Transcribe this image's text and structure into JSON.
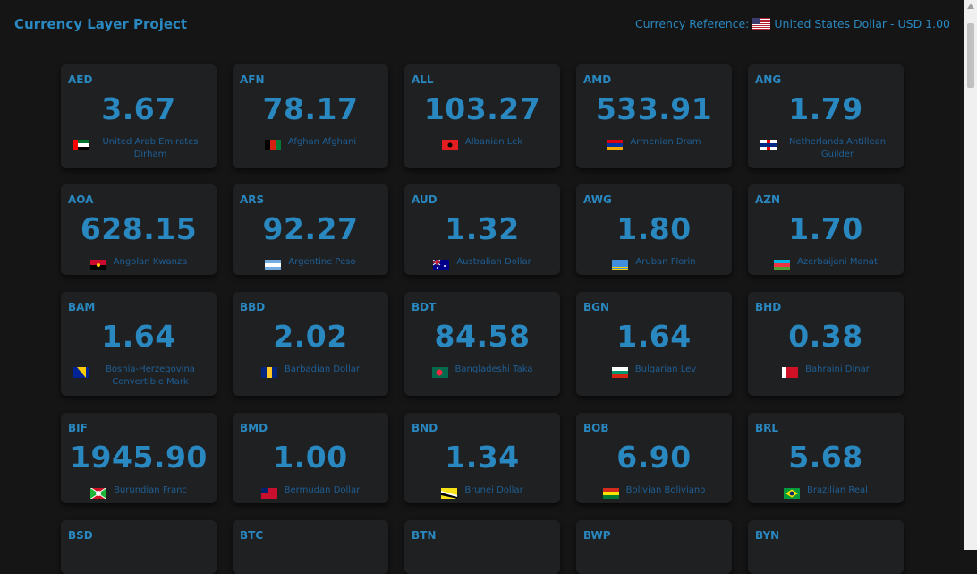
{
  "header": {
    "title": "Currency Layer Project",
    "reference_label": "Currency Reference:",
    "reference_value": "United States Dollar - USD 1.00",
    "reference_flag": "us-flag-icon"
  },
  "currencies": [
    {
      "code": "AED",
      "rate": "3.67",
      "name": "United Arab Emirates Dirham",
      "flag": "ae-flag-icon"
    },
    {
      "code": "AFN",
      "rate": "78.17",
      "name": "Afghan Afghani",
      "flag": "af-flag-icon"
    },
    {
      "code": "ALL",
      "rate": "103.27",
      "name": "Albanian Lek",
      "flag": "al-flag-icon"
    },
    {
      "code": "AMD",
      "rate": "533.91",
      "name": "Armenian Dram",
      "flag": "am-flag-icon"
    },
    {
      "code": "ANG",
      "rate": "1.79",
      "name": "Netherlands Antillean Guilder",
      "flag": "an-flag-icon"
    },
    {
      "code": "AOA",
      "rate": "628.15",
      "name": "Angolan Kwanza",
      "flag": "ao-flag-icon"
    },
    {
      "code": "ARS",
      "rate": "92.27",
      "name": "Argentine Peso",
      "flag": "ar-flag-icon"
    },
    {
      "code": "AUD",
      "rate": "1.32",
      "name": "Australian Dollar",
      "flag": "au-flag-icon"
    },
    {
      "code": "AWG",
      "rate": "1.80",
      "name": "Aruban Florin",
      "flag": "aw-flag-icon"
    },
    {
      "code": "AZN",
      "rate": "1.70",
      "name": "Azerbaijani Manat",
      "flag": "az-flag-icon"
    },
    {
      "code": "BAM",
      "rate": "1.64",
      "name": "Bosnia-Herzegovina Convertible Mark",
      "flag": "ba-flag-icon"
    },
    {
      "code": "BBD",
      "rate": "2.02",
      "name": "Barbadian Dollar",
      "flag": "bb-flag-icon"
    },
    {
      "code": "BDT",
      "rate": "84.58",
      "name": "Bangladeshi Taka",
      "flag": "bd-flag-icon"
    },
    {
      "code": "BGN",
      "rate": "1.64",
      "name": "Bulgarian Lev",
      "flag": "bg-flag-icon"
    },
    {
      "code": "BHD",
      "rate": "0.38",
      "name": "Bahraini Dinar",
      "flag": "bh-flag-icon"
    },
    {
      "code": "BIF",
      "rate": "1945.90",
      "name": "Burundian Franc",
      "flag": "bi-flag-icon"
    },
    {
      "code": "BMD",
      "rate": "1.00",
      "name": "Bermudan Dollar",
      "flag": "bm-flag-icon"
    },
    {
      "code": "BND",
      "rate": "1.34",
      "name": "Brunei Dollar",
      "flag": "bn-flag-icon"
    },
    {
      "code": "BOB",
      "rate": "6.90",
      "name": "Bolivian Boliviano",
      "flag": "bo-flag-icon"
    },
    {
      "code": "BRL",
      "rate": "5.68",
      "name": "Brazilian Real",
      "flag": "br-flag-icon"
    },
    {
      "code": "BSD",
      "rate": "",
      "name": "",
      "flag": ""
    },
    {
      "code": "BTC",
      "rate": "",
      "name": "",
      "flag": ""
    },
    {
      "code": "BTN",
      "rate": "",
      "name": "",
      "flag": ""
    },
    {
      "code": "BWP",
      "rate": "",
      "name": "",
      "flag": ""
    },
    {
      "code": "BYN",
      "rate": "",
      "name": "",
      "flag": ""
    }
  ],
  "colors": {
    "background": "#151515",
    "card": "#1f2022",
    "accent": "#2a88c0",
    "name_text": "#1f5f95"
  }
}
